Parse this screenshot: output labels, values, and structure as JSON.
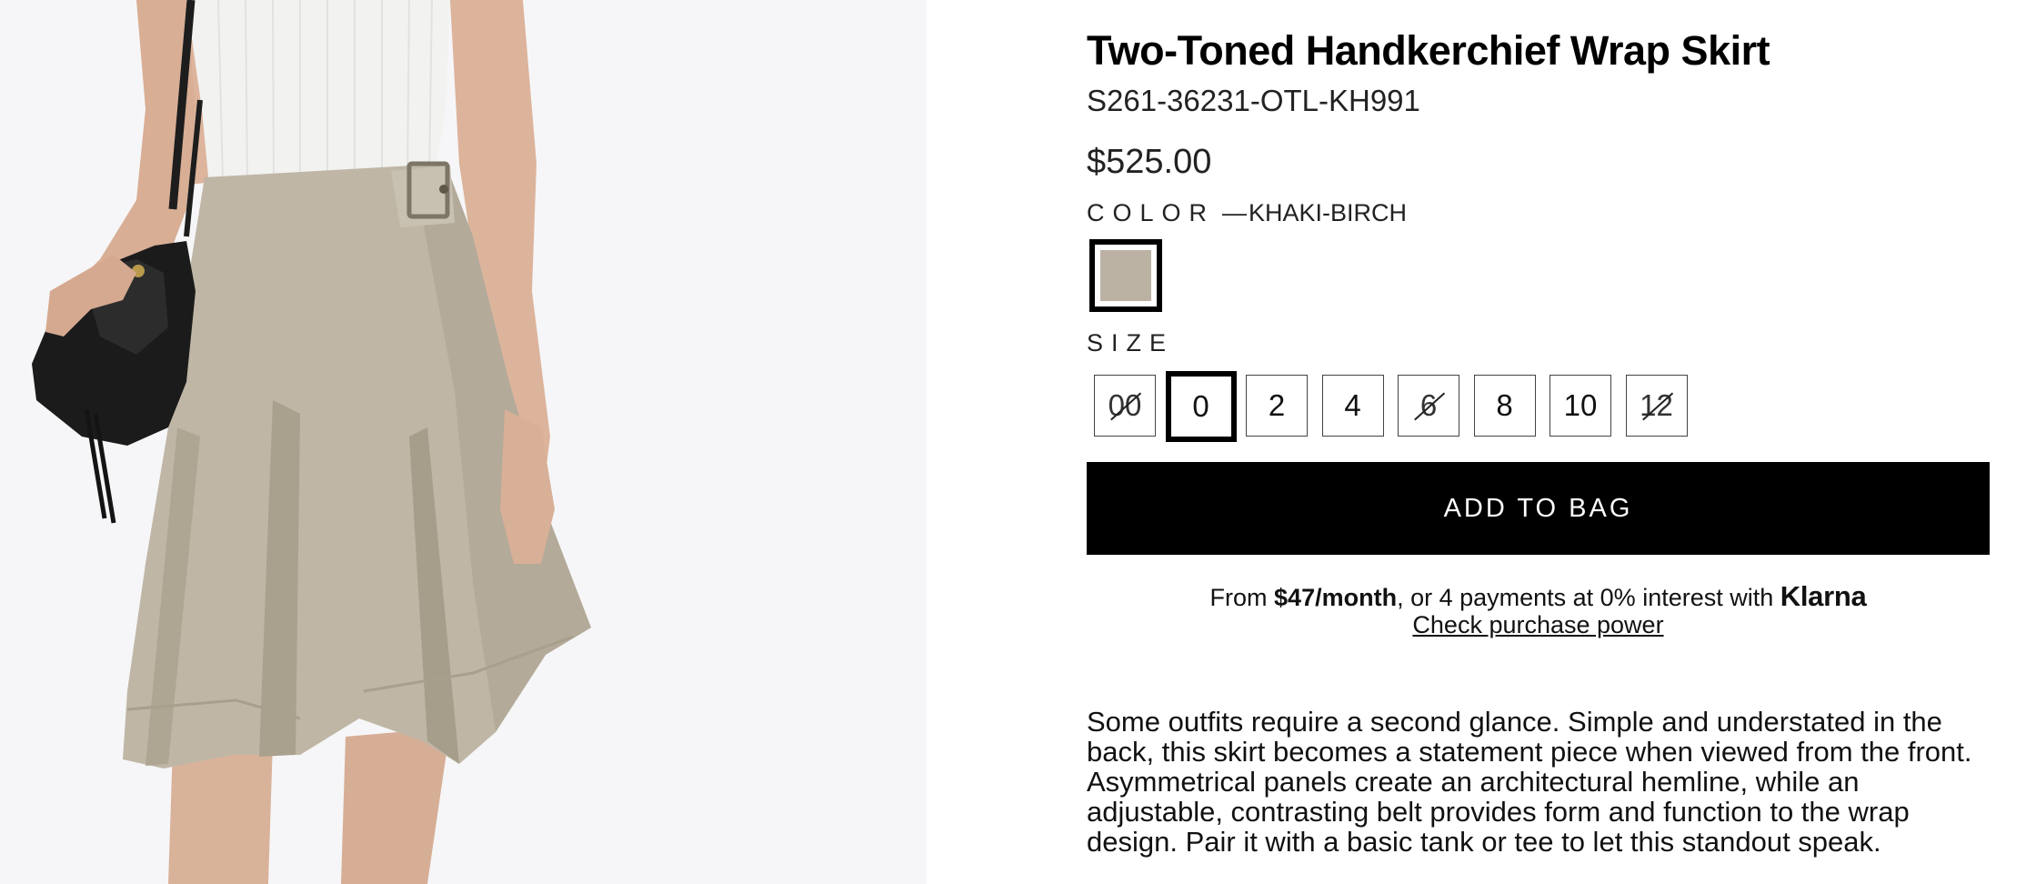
{
  "product": {
    "title": "Two-Toned Handkerchief Wrap Skirt",
    "sku": "S261-36231-OTL-KH991",
    "price": "$525.00",
    "image_alt": "Model wearing khaki wrap skirt with black handbag"
  },
  "color": {
    "label": "COLOR",
    "selected_prefix": "—",
    "selected": "KHAKI-BIRCH",
    "swatch_hex": "#bcb2a4"
  },
  "size": {
    "label": "SIZE",
    "options": [
      {
        "label": "00",
        "available": false,
        "selected": false
      },
      {
        "label": "0",
        "available": true,
        "selected": true
      },
      {
        "label": "2",
        "available": true,
        "selected": false
      },
      {
        "label": "4",
        "available": true,
        "selected": false
      },
      {
        "label": "6",
        "available": false,
        "selected": false
      },
      {
        "label": "8",
        "available": true,
        "selected": false
      },
      {
        "label": "10",
        "available": true,
        "selected": false
      },
      {
        "label": "12",
        "available": false,
        "selected": false
      }
    ]
  },
  "cta": {
    "add_to_bag": "ADD TO BAG"
  },
  "financing": {
    "prefix": "From",
    "monthly": "$47/month",
    "middle": ", or 4 payments at 0% interest with",
    "provider": "Klarna",
    "link": "Check purchase power"
  },
  "description": "Some outfits require a second glance. Simple and understated in the back, this skirt becomes a statement piece when viewed from the front. Asymmetrical panels create an architectural hemline, while an adjustable, contrasting belt provides form and function to the wrap design. Pair it with a basic tank or tee to let this standout speak.",
  "colors": {
    "button_bg": "#000000",
    "skirt": "#bfb6a6",
    "swatch": "#bcb2a4"
  }
}
